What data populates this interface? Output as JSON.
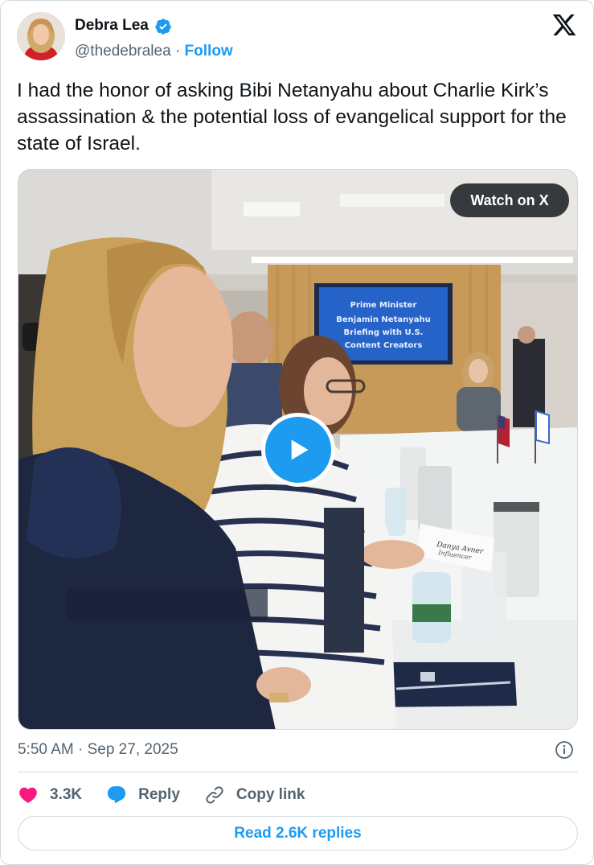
{
  "author": {
    "name": "Debra Lea",
    "handle": "@thedebralea",
    "separator": "·",
    "follow_label": "Follow",
    "verified": true
  },
  "tweet": {
    "text": "I had the honor of asking Bibi Netanyahu about Charlie Kirk’s assassination & the potential loss of evangelical support for the state of Israel.",
    "timestamp": "5:50 AM · Sep 27, 2025"
  },
  "media": {
    "watch_label": "Watch on X",
    "screen_lines": [
      "Prime Minister",
      "Benjamin Netanyahu",
      "Briefing with U.S.",
      "Content Creators"
    ],
    "placard_lines": [
      "Danya Avner",
      "Influencer"
    ]
  },
  "actions": {
    "like_count": "3.3K",
    "reply_label": "Reply",
    "copy_link_label": "Copy link",
    "read_replies_label": "Read 2.6K replies"
  },
  "colors": {
    "accent": "#1d9bf0",
    "like": "#f91880",
    "text_secondary": "#536471",
    "border": "#cfd9de"
  },
  "icons": [
    "verified-badge-icon",
    "x-logo-icon",
    "play-icon",
    "info-icon",
    "heart-icon",
    "reply-bubble-icon",
    "link-icon"
  ]
}
